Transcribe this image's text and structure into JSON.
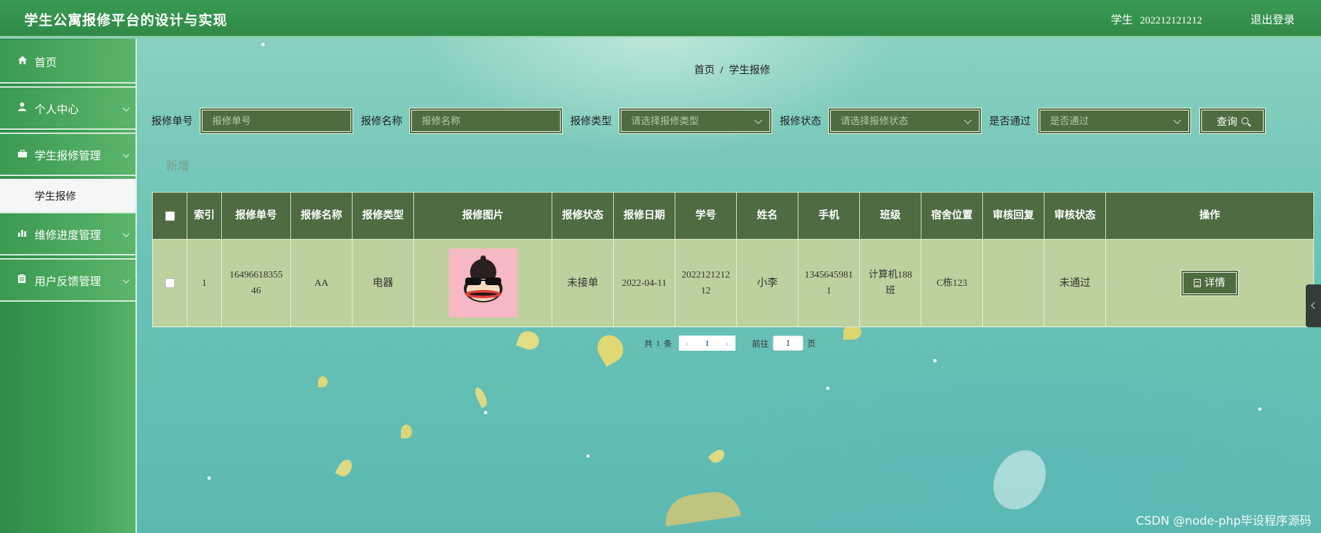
{
  "header": {
    "title": "学生公寓报修平台的设计与实现",
    "role": "学生",
    "user_id": "202212121212",
    "logout": "退出登录"
  },
  "sidebar": {
    "items": [
      {
        "label": "首页",
        "icon": "home-icon"
      },
      {
        "label": "个人中心",
        "icon": "user-icon"
      },
      {
        "label": "学生报修管理",
        "icon": "briefcase-icon"
      },
      {
        "label": "维修进度管理",
        "icon": "bar-chart-icon"
      },
      {
        "label": "用户反馈管理",
        "icon": "clipboard-icon"
      }
    ],
    "active_sub": "学生报修"
  },
  "breadcrumb": {
    "home": "首页",
    "sep": "/",
    "current": "学生报修"
  },
  "search": {
    "order_no_label": "报修单号",
    "order_no_placeholder": "报修单号",
    "name_label": "报修名称",
    "name_placeholder": "报修名称",
    "type_label": "报修类型",
    "type_placeholder": "请选择报修类型",
    "status_label": "报修状态",
    "status_placeholder": "请选择报修状态",
    "passed_label": "是否通过",
    "passed_placeholder": "是否通过",
    "query_button": "查询"
  },
  "add_button": "新增",
  "table": {
    "headers": [
      "索引",
      "报修单号",
      "报修名称",
      "报修类型",
      "报修图片",
      "报修状态",
      "报修日期",
      "学号",
      "姓名",
      "手机",
      "班级",
      "宿舍位置",
      "审核回复",
      "审核状态",
      "操作"
    ],
    "rows": [
      {
        "index": "1",
        "order_no": "1649661835546",
        "name": "AA",
        "type": "电器",
        "status": "未接单",
        "date": "2022-04-11",
        "student_no": "202212121212",
        "student_name": "小李",
        "phone": "13456459811",
        "class": "计算机188班",
        "dorm": "C栋123",
        "review_reply": "",
        "review_status": "未通过",
        "action": "详情"
      }
    ]
  },
  "pagination": {
    "total_prefix": "共",
    "total": "1",
    "total_suffix": "条",
    "current_page": "1",
    "goto_prefix": "前往",
    "goto_value": "1",
    "goto_suffix": "页"
  },
  "watermark": "CSDN @node-php毕设程序源码",
  "colors": {
    "header_green": "#2f8a47",
    "sidebar_green": "#3fa055",
    "control_dark_green": "#4f6b40",
    "row_light_green": "#bcd19d"
  }
}
